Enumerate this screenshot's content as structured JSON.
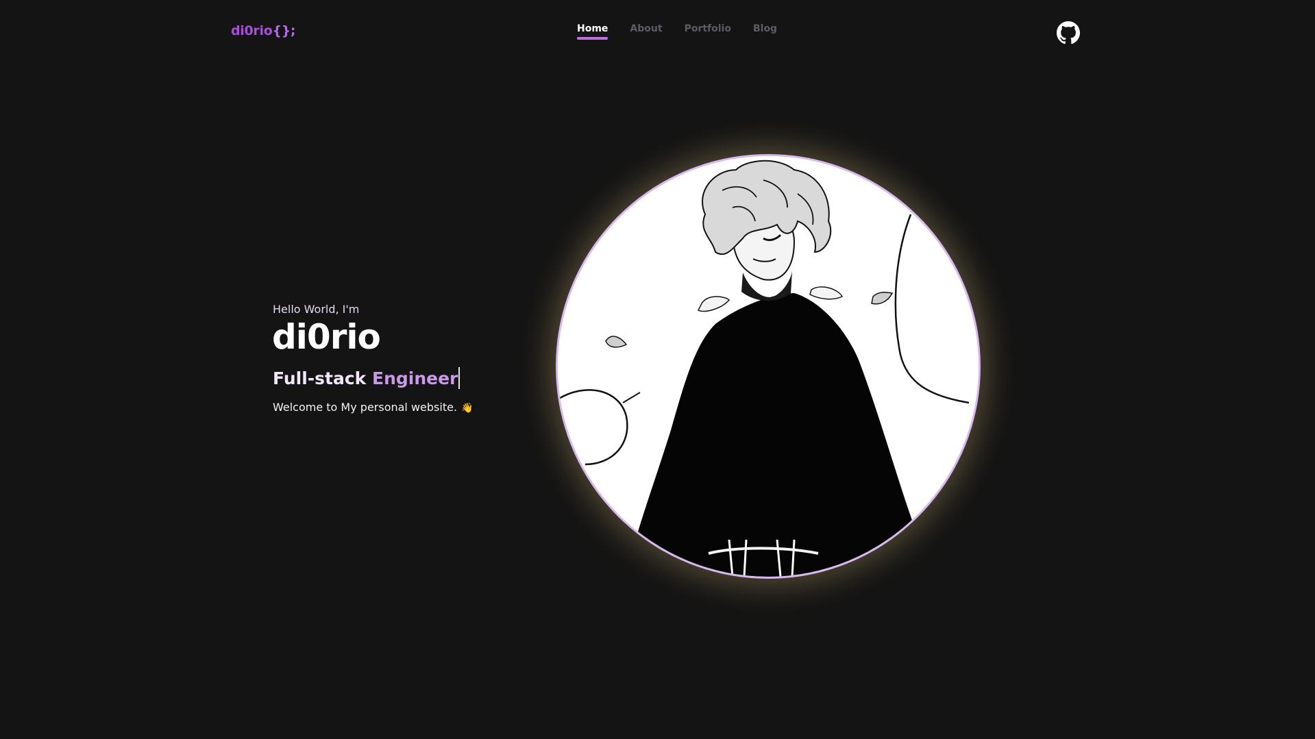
{
  "header": {
    "logo_name": "di0rio",
    "logo_braces": "{};",
    "nav": [
      {
        "label": "Home",
        "active": true
      },
      {
        "label": "About",
        "active": false
      },
      {
        "label": "Portfolio",
        "active": false
      },
      {
        "label": "Blog",
        "active": false
      }
    ],
    "github_icon": "github-icon"
  },
  "hero": {
    "greeting": "Hello World, I'm",
    "name": "di0rio",
    "role_prefix": "Full-stack ",
    "role_accent": "Engineer",
    "welcome": "Welcome to My personal website.",
    "wave_icon": "👋"
  },
  "colors": {
    "background": "#141414",
    "accent": "#a64fd9",
    "nav_underline": "#c06ee8",
    "avatar_border": "#d9b8f0"
  }
}
